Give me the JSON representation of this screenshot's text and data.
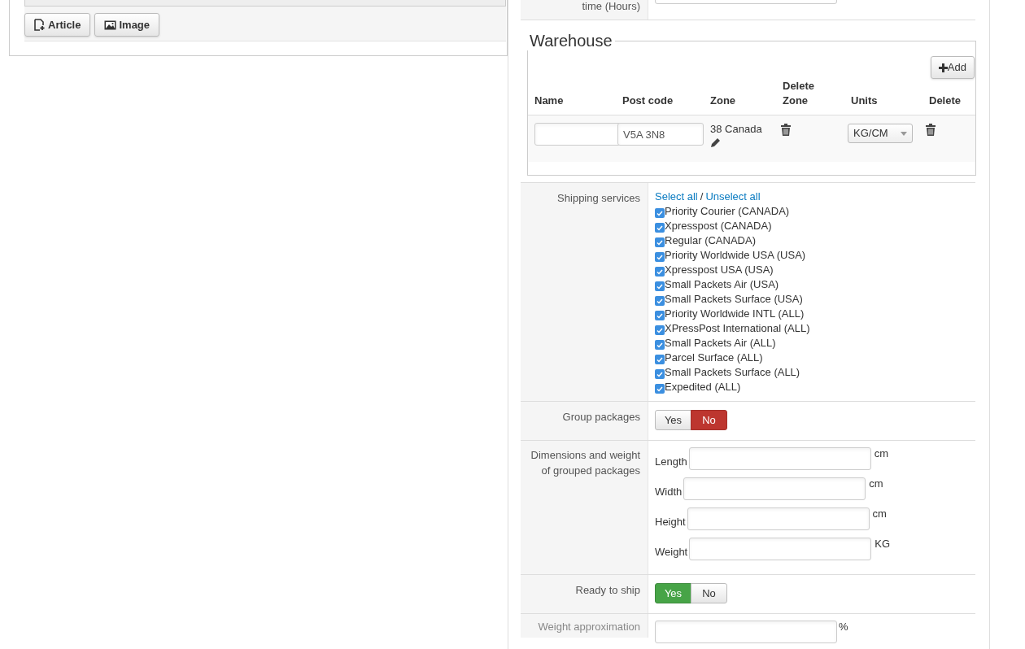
{
  "editor": {
    "buttons": [
      {
        "label": "Article",
        "kind": "article"
      },
      {
        "label": "Image",
        "kind": "image"
      }
    ]
  },
  "form": {
    "top_row": {
      "label": "time (Hours)"
    },
    "warehouse": {
      "title": "Warehouse",
      "add_button": "Add",
      "columns": [
        "Name",
        "Post code",
        "Zone",
        "Delete Zone",
        "Units",
        "Delete"
      ],
      "rows": [
        {
          "post_code": "V5A 3N8",
          "zone": "38 Canada",
          "units": "KG/CM"
        }
      ]
    },
    "shipping_services": {
      "label": "Shipping services",
      "select_all": "Select all",
      "separator": "/",
      "unselect_all": "Unselect all",
      "services": [
        {
          "label": "Priority Courier (CANADA)",
          "checked": true
        },
        {
          "label": "Xpresspost (CANADA)",
          "checked": true
        },
        {
          "label": "Regular (CANADA)",
          "checked": true
        },
        {
          "label": "Priority Worldwide USA (USA)",
          "checked": true
        },
        {
          "label": "Xpresspost USA (USA)",
          "checked": true
        },
        {
          "label": "Small Packets Air (USA)",
          "checked": true
        },
        {
          "label": "Small Packets Surface (USA)",
          "checked": true
        },
        {
          "label": "Priority Worldwide INTL (ALL)",
          "checked": true
        },
        {
          "label": "XPressPost International (ALL)",
          "checked": true
        },
        {
          "label": "Small Packets Air (ALL)",
          "checked": true
        },
        {
          "label": "Parcel Surface (ALL)",
          "checked": true
        },
        {
          "label": "Small Packets Surface (ALL)",
          "checked": true
        },
        {
          "label": "Expedited (ALL)",
          "checked": true
        }
      ]
    },
    "group_packages": {
      "label": "Group packages",
      "options": [
        {
          "label": "Yes",
          "selected": false
        },
        {
          "label": "No",
          "selected": true
        }
      ]
    },
    "dimensions": {
      "label": "Dimensions and weight of grouped packages",
      "fields": [
        {
          "label": "Length",
          "unit": "cm"
        },
        {
          "label": "Width",
          "unit": "cm"
        },
        {
          "label": "Height",
          "unit": "cm"
        },
        {
          "label": "Weight",
          "unit": "KG"
        }
      ]
    },
    "ready_to_ship": {
      "label": "Ready to ship",
      "options": [
        {
          "label": "Yes",
          "selected": true
        },
        {
          "label": "No",
          "selected": false
        }
      ]
    },
    "weight_approximation": {
      "label": "Weight approximation",
      "unit": "%"
    }
  }
}
